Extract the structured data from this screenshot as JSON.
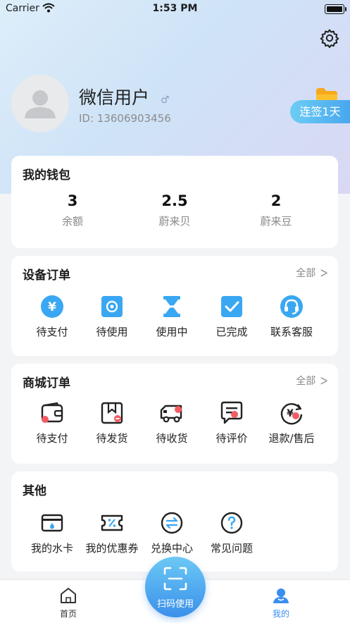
{
  "status_bar": {
    "carrier": "Carrier",
    "time": "1:53 PM"
  },
  "profile": {
    "name": "微信用户",
    "gender_symbol": "♂",
    "id": "ID: 13606903456",
    "sign_in": "连签1天"
  },
  "wallet": {
    "title": "我的钱包",
    "stats": [
      {
        "value": "3",
        "label": "余额"
      },
      {
        "value": "2.5",
        "label": "蔚来贝"
      },
      {
        "value": "2",
        "label": "蔚来豆"
      }
    ]
  },
  "device_orders": {
    "title": "设备订单",
    "all": "全部",
    "items": [
      {
        "label": "待支付",
        "icon": "yen-coin-icon"
      },
      {
        "label": "待使用",
        "icon": "flower-icon"
      },
      {
        "label": "使用中",
        "icon": "hourglass-icon"
      },
      {
        "label": "已完成",
        "icon": "check-icon"
      },
      {
        "label": "联系客服",
        "icon": "headset-icon"
      }
    ]
  },
  "mall_orders": {
    "title": "商城订单",
    "all": "全部",
    "items": [
      {
        "label": "待支付",
        "icon": "wallet-icon"
      },
      {
        "label": "待发货",
        "icon": "package-icon"
      },
      {
        "label": "待收货",
        "icon": "truck-icon"
      },
      {
        "label": "待评价",
        "icon": "comment-icon"
      },
      {
        "label": "退款/售后",
        "icon": "refund-icon"
      }
    ]
  },
  "others": {
    "title": "其他",
    "items": [
      {
        "label": "我的水卡",
        "icon": "card-icon"
      },
      {
        "label": "我的优惠券",
        "icon": "coupon-icon"
      },
      {
        "label": "兑换中心",
        "icon": "exchange-icon"
      },
      {
        "label": "常见问题",
        "icon": "question-icon"
      }
    ]
  },
  "tabbar": {
    "home": "首页",
    "scan": "扫码使用",
    "mine": "我的"
  },
  "colors": {
    "accent": "#3aa0f0",
    "badge": "#f25d64",
    "active_tab": "#3a8ef0"
  }
}
